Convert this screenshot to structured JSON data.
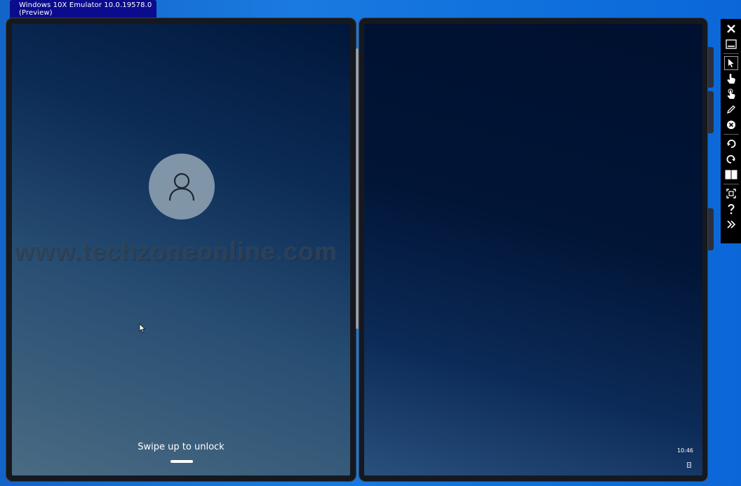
{
  "window": {
    "title": "Windows 10X Emulator 10.0.19578.0 (Preview)"
  },
  "lock_screen": {
    "watermark": "www.techzoneonline.com",
    "swipe_text": "Swipe up to unlock"
  },
  "right_screen": {
    "clock": "10:46"
  },
  "toolbar": {
    "buttons": [
      {
        "icon": "close-icon"
      },
      {
        "icon": "minimize-icon"
      },
      {
        "icon": "pointer-icon",
        "selected": true
      },
      {
        "icon": "single-touch-icon"
      },
      {
        "icon": "multi-touch-icon"
      },
      {
        "icon": "pen-icon"
      },
      {
        "icon": "cancel-circle-icon"
      },
      {
        "icon": "rotate-left-icon"
      },
      {
        "icon": "rotate-right-icon"
      },
      {
        "icon": "dual-screen-icon"
      },
      {
        "icon": "fit-screen-icon"
      },
      {
        "icon": "help-icon"
      },
      {
        "icon": "expand-tools-icon"
      }
    ]
  },
  "colors": {
    "desktop_blue": "#1a7ae0",
    "title_tab": "#0b0b8e",
    "avatar": "#8195a8"
  }
}
